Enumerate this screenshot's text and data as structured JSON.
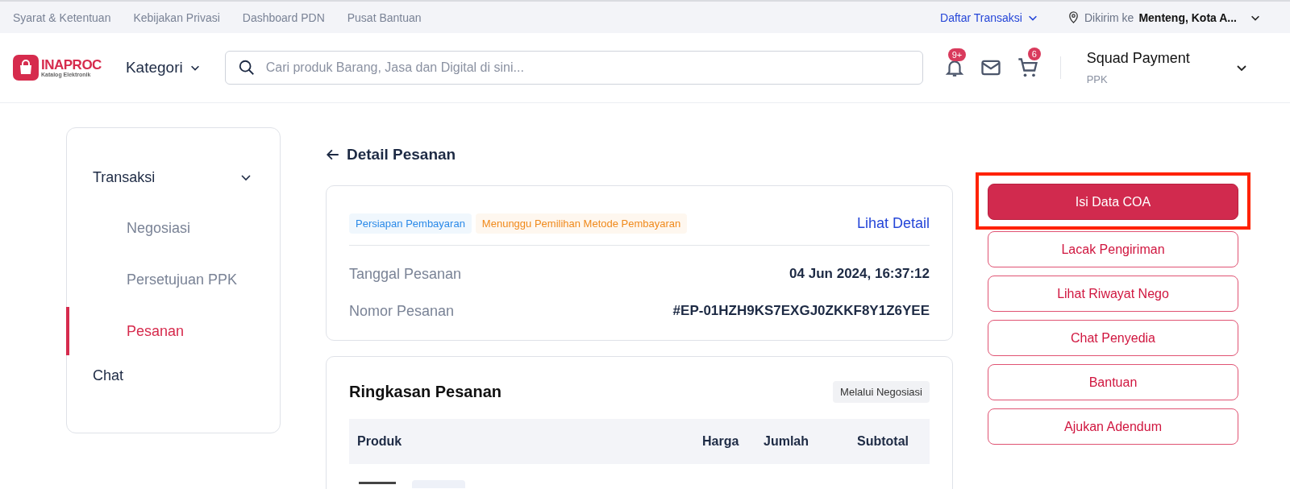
{
  "top_links": [
    "Syarat & Ketentuan",
    "Kebijakan Privasi",
    "Dashboard PDN",
    "Pusat Bantuan"
  ],
  "top_right": {
    "transactions_link": "Daftar Transaksi",
    "ship_label": "Dikirim ke",
    "ship_location": "Menteng, Kota A..."
  },
  "header": {
    "logo_title": "INAPROC",
    "logo_subtitle": "Katalog Elektronik",
    "category_menu": "Kategori",
    "search": {
      "placeholder": "Cari produk Barang, Jasa dan Digital di sini..."
    },
    "notification_badge": "9+",
    "cart_badge": "6",
    "user_name": "Squad Payment",
    "user_role": "PPK"
  },
  "sidebar": {
    "items": [
      {
        "label": "Transaksi",
        "expanded": true,
        "children": [
          {
            "label": "Negosiasi",
            "selected": false
          },
          {
            "label": "Persetujuan PPK",
            "selected": false
          },
          {
            "label": "Pesanan",
            "selected": true
          }
        ]
      },
      {
        "label": "Chat"
      }
    ]
  },
  "page_title": "Detail Pesanan",
  "order_card": {
    "tags": [
      {
        "label": "Persiapan Pembayaran",
        "color": "#2b8ae8"
      },
      {
        "label": "Menunggu Pemilihan Metode Pembayaran",
        "color": "#f08a1c"
      }
    ],
    "detail_link": "Lihat Detail",
    "fields": [
      {
        "label": "Tanggal Pesanan",
        "value": "04 Jun 2024, 16:37:12"
      },
      {
        "label": "Nomor Pesanan",
        "value": "#EP-01HZH9KS7EXGJ0ZKKF8Y1Z6YEE"
      }
    ]
  },
  "summary": {
    "title": "Ringkasan Pesanan",
    "badge": "Melalui Negosiasi",
    "columns": [
      "Produk",
      "Harga",
      "Jumlah",
      "Subtotal"
    ]
  },
  "actions": [
    {
      "label": "Isi Data COA",
      "kind": "primary",
      "highlighted": true
    },
    {
      "label": "Lacak Pengiriman",
      "kind": "outline",
      "highlighted": false
    },
    {
      "label": "Lihat Riwayat Nego",
      "kind": "outline",
      "highlighted": false
    },
    {
      "label": "Chat Penyedia",
      "kind": "outline",
      "highlighted": false
    },
    {
      "label": "Bantuan",
      "kind": "outline",
      "highlighted": false
    },
    {
      "label": "Ajukan Adendum",
      "kind": "outline",
      "highlighted": false
    }
  ]
}
